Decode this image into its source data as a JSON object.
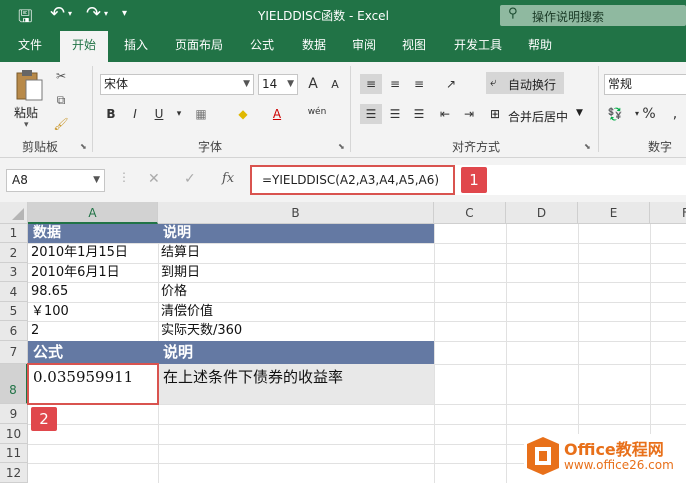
{
  "title_bar": {
    "title": "YIELDDISC函数 - Excel",
    "search_placeholder": "操作说明搜索",
    "qat": {
      "save": "🖫",
      "undo": "↶",
      "redo": "↷",
      "customize": "▾"
    }
  },
  "tabs": [
    {
      "label": "文件"
    },
    {
      "label": "开始"
    },
    {
      "label": "插入"
    },
    {
      "label": "页面布局"
    },
    {
      "label": "公式"
    },
    {
      "label": "数据"
    },
    {
      "label": "审阅"
    },
    {
      "label": "视图"
    },
    {
      "label": "开发工具"
    },
    {
      "label": "帮助"
    }
  ],
  "ribbon": {
    "clipboard": {
      "label": "剪贴板",
      "paste": "粘贴"
    },
    "font": {
      "label": "字体",
      "name": "宋体",
      "size": "14",
      "bold": "B",
      "italic": "I",
      "underline": "U",
      "grow": "A",
      "shrink": "A",
      "fill_icon": "◆",
      "font_color_icon": "A",
      "wen": "wén"
    },
    "alignment": {
      "label": "对齐方式",
      "wrap": "自动换行",
      "merge": "合并后居中"
    },
    "number": {
      "label": "数字",
      "format": "常规",
      "percent": "%"
    }
  },
  "formula_bar": {
    "name_box": "A8",
    "cancel": "✕",
    "enter": "✓",
    "fx": "fx",
    "formula": "=YIELDDISC(A2,A3,A4,A5,A6)",
    "badge": "1"
  },
  "columns": [
    {
      "label": "A"
    },
    {
      "label": "B"
    },
    {
      "label": "C"
    },
    {
      "label": "D"
    },
    {
      "label": "E"
    },
    {
      "label": "F"
    }
  ],
  "rows": [
    "1",
    "2",
    "3",
    "4",
    "5",
    "6",
    "7",
    "8",
    "9",
    "10",
    "11",
    "12"
  ],
  "cells": {
    "A1": "数据",
    "B1": "说明",
    "A2": "2010年1月15日",
    "B2": "结算日",
    "A3": "2010年6月1日",
    "B3": "到期日",
    "A4": "98.65",
    "B4": "价格",
    "A5": "￥100",
    "B5": "清偿价值",
    "A6": "2",
    "B6": "实际天数/360",
    "A7": "公式",
    "B7": "说明",
    "A8": "0.035959911",
    "B8": "在上述条件下债券的收益率"
  },
  "cell_badge": "2",
  "watermark": {
    "brand": "Office教程网",
    "url": "www.office26.com"
  },
  "colors": {
    "brand": "#217346",
    "header_band": "#6479a3",
    "highlight": "#d9534f"
  }
}
